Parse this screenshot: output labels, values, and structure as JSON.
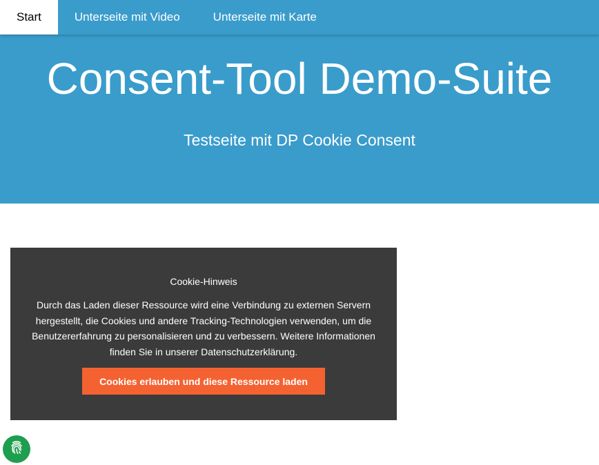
{
  "nav": {
    "items": [
      {
        "label": "Start",
        "active": true
      },
      {
        "label": "Unterseite mit Video",
        "active": false
      },
      {
        "label": "Unterseite mit Karte",
        "active": false
      }
    ]
  },
  "hero": {
    "title": "Consent-Tool Demo-Suite",
    "subtitle": "Testseite mit DP Cookie Consent"
  },
  "consent": {
    "heading": "Cookie-Hinweis",
    "text": "Durch das Laden dieser Ressource wird eine Verbindung zu externen Servern hergestellt, die Cookies und andere Tracking-Technologien verwenden, um die Benutzererfahrung zu personalisieren und zu verbessern. Weitere Informationen finden Sie in unserer Datenschutzerklärung.",
    "button_label": "Cookies erlauben und diese Ressource laden"
  },
  "fingerprint_button": {
    "icon": "fingerprint-icon"
  },
  "colors": {
    "primary": "#3a9ccb",
    "consent_background": "#3b3b3b",
    "consent_button": "#f46232",
    "fingerprint_button": "#1e9e4f"
  }
}
